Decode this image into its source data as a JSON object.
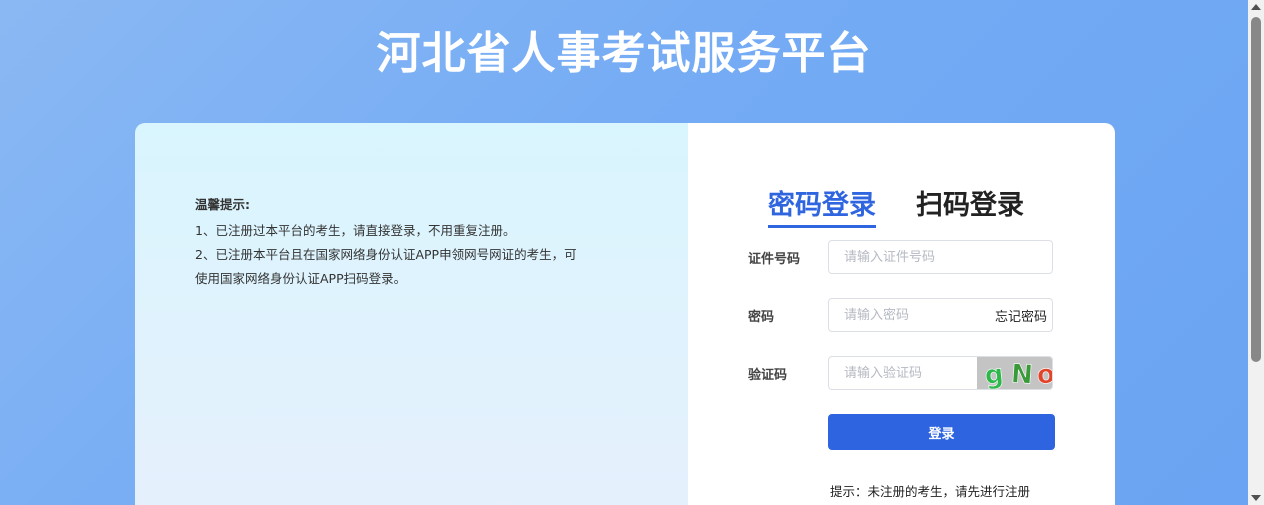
{
  "header": {
    "title": "河北省人事考试服务平台"
  },
  "tips": {
    "title": "温馨提示:",
    "lines": [
      "1、已注册过本平台的考生，请直接登录，不用重复注册。",
      "2、已注册本平台且在国家网络身份认证APP申领网号网证的考生，可使用国家网络身份认证APP扫码登录。"
    ]
  },
  "tabs": [
    {
      "label": "密码登录",
      "active": true
    },
    {
      "label": "扫码登录",
      "active": false
    }
  ],
  "form": {
    "id_label": "证件号码",
    "id_placeholder": "请输入证件号码",
    "id_value": "",
    "password_label": "密码",
    "password_placeholder": "请输入密码",
    "password_value": "",
    "forgot_label": "忘记密码",
    "captcha_label": "验证码",
    "captcha_placeholder": "请输入验证码",
    "captcha_value": "",
    "captcha_text": "gNoH",
    "login_label": "登录",
    "hint": "提示：未注册的考生，请先进行注册"
  },
  "colors": {
    "accent": "#2e64e0",
    "background": "#74abf4",
    "captcha_chars": [
      "#2eb84c",
      "#3a9a3a",
      "#e0452c",
      "#2eb84c"
    ]
  }
}
